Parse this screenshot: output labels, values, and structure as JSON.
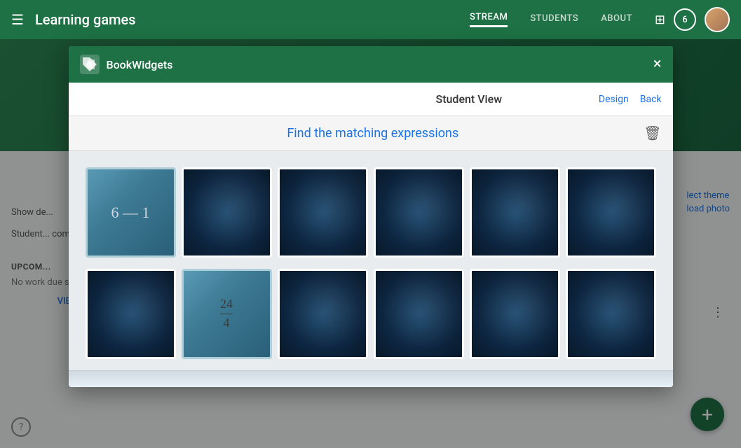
{
  "app": {
    "title": "Learning games"
  },
  "nav": {
    "hamburger_label": "☰",
    "tabs": [
      {
        "id": "stream",
        "label": "STREAM",
        "active": true
      },
      {
        "id": "students",
        "label": "STUDENTS",
        "active": false
      },
      {
        "id": "about",
        "label": "ABOUT",
        "active": false
      }
    ],
    "grid_icon": "⊞",
    "notification_count": "6",
    "design_link": "Design",
    "back_link": "Back"
  },
  "sidebar": {
    "show_deleted": "Show de...",
    "student_comment": "Student... commen...",
    "upcoming_label": "UPCOM...",
    "no_work": "No work due soon.",
    "view_all": "VIEW ALL"
  },
  "right_options": {
    "select_theme": "lect theme",
    "upload_photo": "load photo"
  },
  "modal": {
    "header_title": "BookWidgets",
    "close_label": "×",
    "student_view_label": "Student View",
    "design_label": "Design",
    "back_label": "Back",
    "game_title": "Find the matching expressions",
    "trash_icon": "🗑"
  },
  "cards": {
    "row1": [
      {
        "id": "c1",
        "type": "light",
        "text": "6 — 1",
        "selected": true
      },
      {
        "id": "c2",
        "type": "dark",
        "text": "",
        "selected": false
      },
      {
        "id": "c3",
        "type": "dark",
        "text": "",
        "selected": false
      },
      {
        "id": "c4",
        "type": "dark",
        "text": "",
        "selected": false
      },
      {
        "id": "c5",
        "type": "dark",
        "text": "",
        "selected": false
      },
      {
        "id": "c6",
        "type": "dark",
        "text": "",
        "selected": false
      }
    ],
    "row2": [
      {
        "id": "c7",
        "type": "dark",
        "text": "",
        "selected": false
      },
      {
        "id": "c8",
        "type": "fraction",
        "num": "24",
        "den": "4",
        "selected": true
      },
      {
        "id": "c9",
        "type": "dark",
        "text": "",
        "selected": false
      },
      {
        "id": "c10",
        "type": "dark",
        "text": "",
        "selected": false
      },
      {
        "id": "c11",
        "type": "dark",
        "text": "",
        "selected": false
      },
      {
        "id": "c12",
        "type": "dark",
        "text": "",
        "selected": false
      }
    ]
  }
}
